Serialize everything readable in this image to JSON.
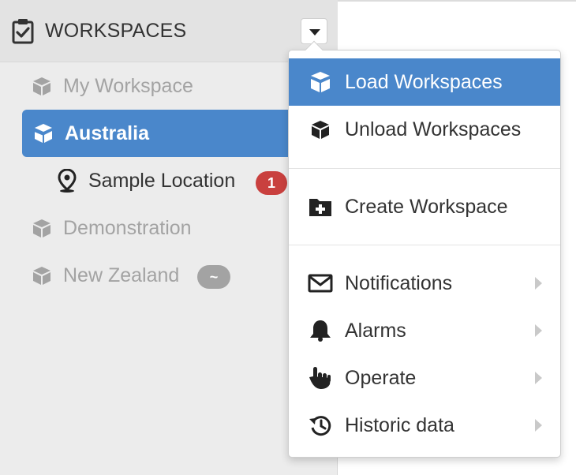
{
  "header": {
    "title": "WORKSPACES"
  },
  "tree": {
    "items": [
      {
        "label": "My Workspace"
      },
      {
        "label": "Australia"
      },
      {
        "label": "Sample Location",
        "badge": "1"
      },
      {
        "label": "Demonstration"
      },
      {
        "label": "New Zealand",
        "badge": "~"
      }
    ]
  },
  "menu": {
    "items": [
      {
        "label": "Load Workspaces"
      },
      {
        "label": "Unload Workspaces"
      },
      {
        "label": "Create Workspace"
      },
      {
        "label": "Notifications"
      },
      {
        "label": "Alarms"
      },
      {
        "label": "Operate"
      },
      {
        "label": "Historic data"
      }
    ]
  },
  "colors": {
    "accent": "#4a87cb",
    "badge_red": "#c9403e",
    "badge_grey": "#a3a3a3"
  }
}
